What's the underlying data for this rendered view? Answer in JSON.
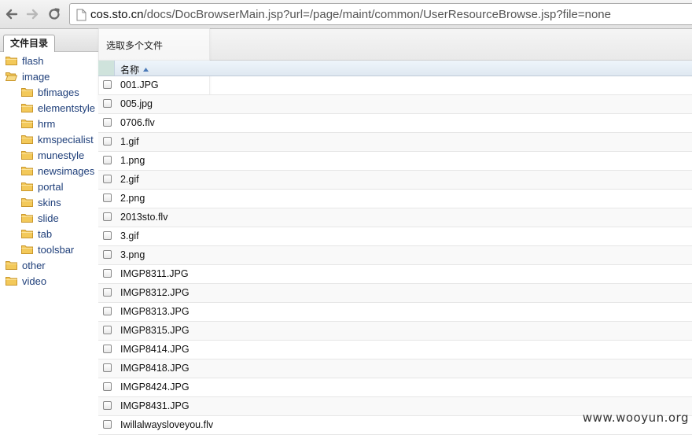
{
  "browser": {
    "url_host": "cos.sto.cn",
    "url_path": "/docs/DocBrowserMain.jsp?url=/page/maint/common/UserResourceBrowse.jsp?file=none"
  },
  "left_panel": {
    "tab_label": "文件目录",
    "tree": [
      {
        "label": "flash",
        "level": 0
      },
      {
        "label": "image",
        "level": 0,
        "expanded": true
      },
      {
        "label": "bfimages",
        "level": 1
      },
      {
        "label": "elementstyle",
        "level": 1
      },
      {
        "label": "hrm",
        "level": 1
      },
      {
        "label": "kmspecialist",
        "level": 1
      },
      {
        "label": "munestyle",
        "level": 1
      },
      {
        "label": "newsimages",
        "level": 1
      },
      {
        "label": "portal",
        "level": 1
      },
      {
        "label": "skins",
        "level": 1
      },
      {
        "label": "slide",
        "level": 1
      },
      {
        "label": "tab",
        "level": 1
      },
      {
        "label": "toolsbar",
        "level": 1
      },
      {
        "label": "other",
        "level": 0
      },
      {
        "label": "video",
        "level": 0
      }
    ]
  },
  "file_list": {
    "select_label": "选取多个文件",
    "column_name": "名称",
    "files": [
      "001.JPG",
      "005.jpg",
      "0706.flv",
      "1.gif",
      "1.png",
      "2.gif",
      "2.png",
      "2013sto.flv",
      "3.gif",
      "3.png",
      "IMGP8311.JPG",
      "IMGP8312.JPG",
      "IMGP8313.JPG",
      "IMGP8315.JPG",
      "IMGP8414.JPG",
      "IMGP8418.JPG",
      "IMGP8424.JPG",
      "IMGP8431.JPG",
      "Iwillalwaysloveyou.flv"
    ]
  },
  "watermark": "www.wooyun.org",
  "colors": {
    "tree_text": "#1f3f7a",
    "folder_fill": "#f3c95a",
    "folder_stroke": "#c9962a"
  }
}
